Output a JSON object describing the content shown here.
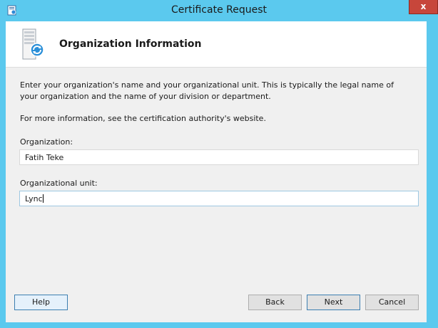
{
  "window": {
    "title": "Certificate Request",
    "close_label": "x"
  },
  "header": {
    "title": "Organization Information"
  },
  "content": {
    "description": "Enter your organization's name and your organizational unit. This is typically the legal name of your organization and the name of your division or department.",
    "more_info": "For more information, see the certification authority's website."
  },
  "form": {
    "organization": {
      "label": "Organization:",
      "value": "Fatih Teke"
    },
    "organizational_unit": {
      "label": "Organizational unit:",
      "value": "Lync"
    }
  },
  "buttons": {
    "help": "Help",
    "back": "Back",
    "next": "Next",
    "cancel": "Cancel"
  },
  "colors": {
    "window_frame": "#5bc9ee",
    "close_button": "#c7463b",
    "client_bg": "#f0f0f0",
    "header_bg": "#ffffff",
    "focus_border": "#3c7fb1"
  },
  "icons": {
    "app": "certificate-app-icon",
    "header": "server-certificate-icon"
  }
}
